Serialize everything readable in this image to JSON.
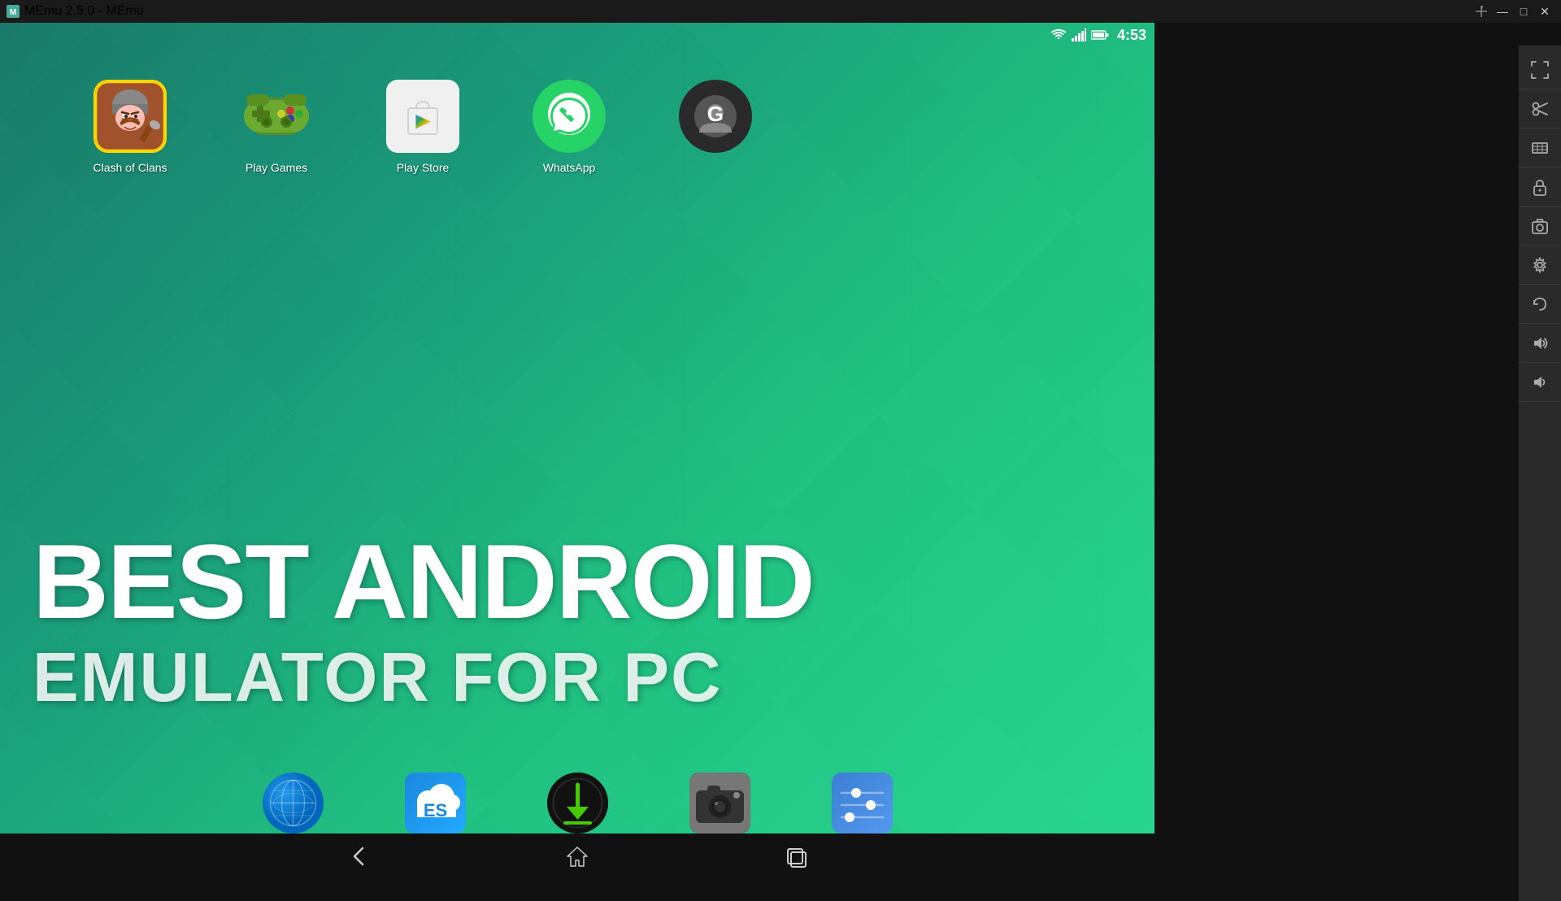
{
  "titleBar": {
    "title": "MEmu 2.5.0 - MEmu",
    "minimize": "—",
    "restore": "□",
    "close": "✕"
  },
  "statusBar": {
    "time": "4:53",
    "wifiIcon": "wifi",
    "signalIcon": "signal",
    "batteryIcon": "battery"
  },
  "apps": [
    {
      "id": "clash-of-clans",
      "label": "Clash of Clans",
      "type": "coc"
    },
    {
      "id": "play-games",
      "label": "Play Games",
      "type": "playgames"
    },
    {
      "id": "play-store",
      "label": "Play Store",
      "type": "playstore"
    },
    {
      "id": "whatsapp",
      "label": "WhatsApp",
      "type": "whatsapp"
    },
    {
      "id": "google",
      "label": "",
      "type": "google"
    }
  ],
  "bigText": {
    "line1": "BEST ANDROID",
    "line2": "EMULATOR FOR PC"
  },
  "dockApps": [
    {
      "id": "browser",
      "label": "Browser",
      "type": "globe"
    },
    {
      "id": "es-explorer",
      "label": "ES File Explorer",
      "type": "es"
    },
    {
      "id": "downloader",
      "label": "Downloader",
      "type": "download"
    },
    {
      "id": "camera",
      "label": "Camera",
      "type": "camera"
    },
    {
      "id": "settings",
      "label": "Settings",
      "type": "settings"
    }
  ],
  "navBar": {
    "backLabel": "◁",
    "homeLabel": "△",
    "recentLabel": "◻"
  },
  "toolbar": {
    "buttons": [
      "expand",
      "scissors",
      "resize",
      "lock",
      "camera",
      "settings",
      "restore",
      "volume-up",
      "volume-down"
    ]
  },
  "pageDots": [
    {
      "active": true
    },
    {
      "active": false
    }
  ]
}
